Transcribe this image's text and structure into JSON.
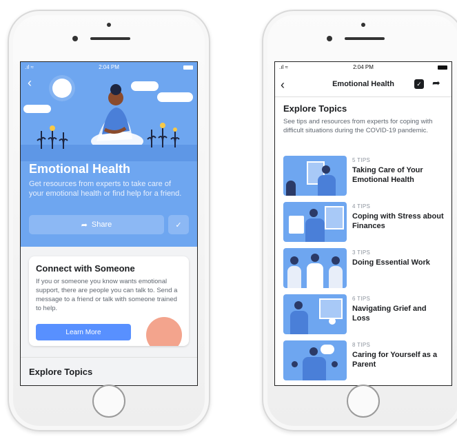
{
  "status_bar": {
    "time": "2:04 PM",
    "signal": ".ıl ≈"
  },
  "left": {
    "back_icon": "chevron-left-icon",
    "hero": {
      "title": "Emotional Health",
      "description": "Get resources from experts to take care of your emotional health or find help for a friend.",
      "share_label": "Share"
    },
    "connect_card": {
      "title": "Connect with Someone",
      "description": "If you or someone you know wants emotional support, there are people you can talk to. Send a message to a friend or talk with someone trained to help.",
      "button_label": "Learn More"
    },
    "explore_title": "Explore Topics"
  },
  "right": {
    "nav_title": "Emotional Health",
    "explore": {
      "title": "Explore Topics",
      "description": "See tips and resources from experts for coping with difficult situations during the COVID-19 pandemic."
    },
    "topics": [
      {
        "tips": "5 TIPS",
        "name": "Taking Care of Your Emotional Health"
      },
      {
        "tips": "4 TIPS",
        "name": "Coping with Stress about Finances"
      },
      {
        "tips": "3 TIPS",
        "name": "Doing Essential Work"
      },
      {
        "tips": "6 TIPS",
        "name": "Navigating Grief and Loss"
      },
      {
        "tips": "8 TIPS",
        "name": "Caring for Yourself as a Parent"
      }
    ]
  },
  "colors": {
    "hero_blue": "#6ea6f0",
    "button_blue": "#5890ff",
    "text_dark": "#1c1e21",
    "text_gray": "#606770"
  }
}
